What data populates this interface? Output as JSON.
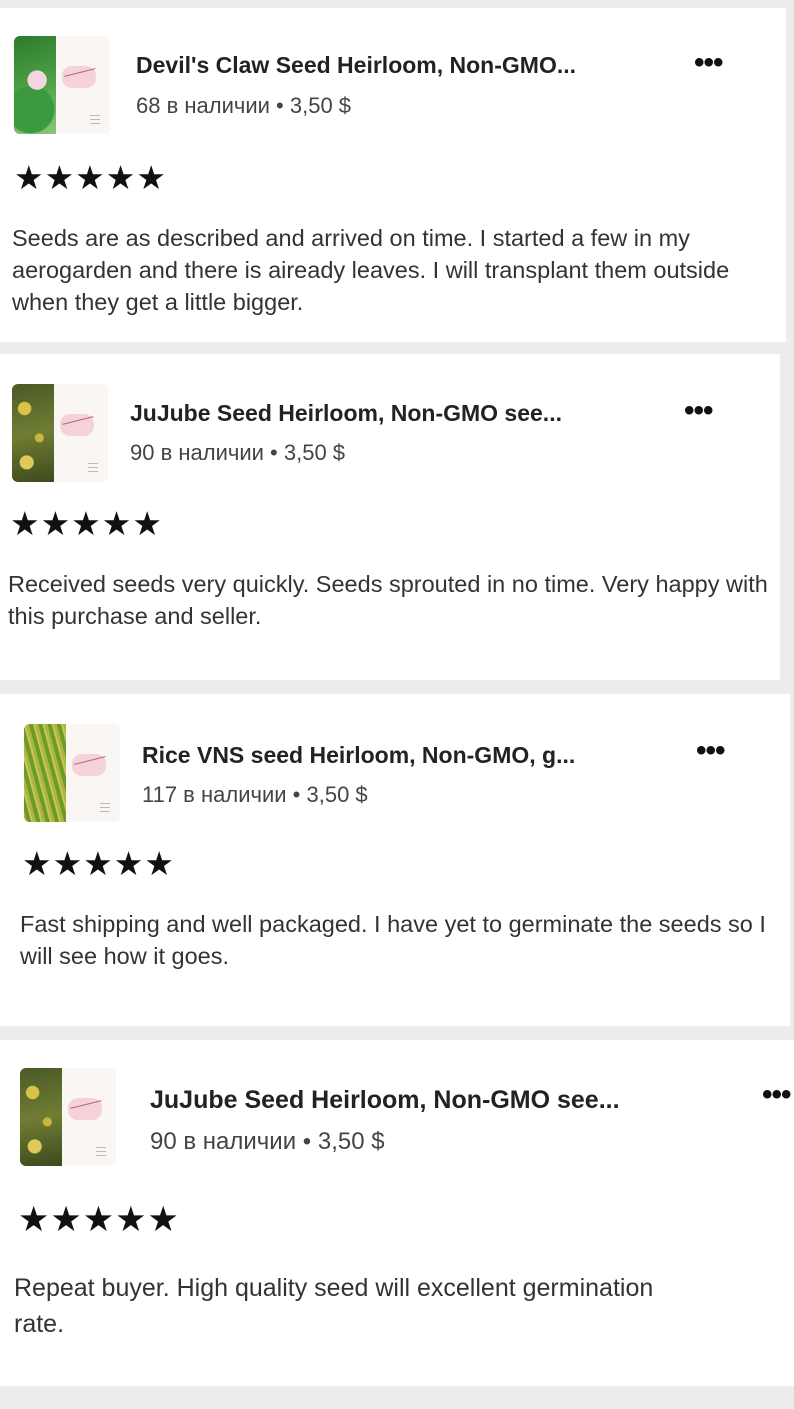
{
  "reviews": [
    {
      "title": "Devil's Claw Seed Heirloom, Non-GMO...",
      "stock": "68 в наличии",
      "price": "3,50 $",
      "rating": 5,
      "stars": "★★★★★",
      "text": "Seeds are as described and arrived on time. I started a few in my aerogarden and there is aiready leaves. I will transplant them outside when they get a little bigger.",
      "thumb": "devils-claw"
    },
    {
      "title": "JuJube Seed Heirloom, Non-GMO see...",
      "stock": "90 в наличии",
      "price": "3,50 $",
      "rating": 5,
      "stars": "★★★★★",
      "text": "Received seeds very quickly. Seeds sprouted in no time. Very happy with this purchase and seller.",
      "thumb": "jujube"
    },
    {
      "title": "Rice VNS seed Heirloom, Non-GMO, g...",
      "stock": "117 в наличии",
      "price": "3,50 $",
      "rating": 5,
      "stars": "★★★★★",
      "text": "Fast shipping and well packaged.  I have yet to germinate the seeds so I will see how it goes.",
      "thumb": "rice"
    },
    {
      "title": "JuJube Seed Heirloom, Non-GMO see...",
      "stock": "90 в наличии",
      "price": "3,50 $",
      "rating": 5,
      "stars": "★★★★★",
      "text": "Repeat buyer.  High quality seed will excellent germination rate.",
      "thumb": "jujube"
    }
  ],
  "meta_separator": " • ",
  "more_glyph": "•••",
  "colors": {
    "background": "#ececec",
    "card": "#ffffff",
    "text": "#222222"
  }
}
